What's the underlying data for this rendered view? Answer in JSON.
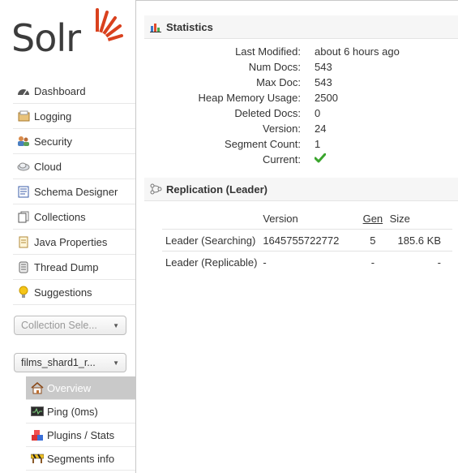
{
  "app": {
    "logo_text": "Solr"
  },
  "sidebar": {
    "items": [
      {
        "label": "Dashboard",
        "icon": "dashboard-icon"
      },
      {
        "label": "Logging",
        "icon": "logging-icon"
      },
      {
        "label": "Security",
        "icon": "security-icon"
      },
      {
        "label": "Cloud",
        "icon": "cloud-icon"
      },
      {
        "label": "Schema Designer",
        "icon": "schema-designer-icon"
      },
      {
        "label": "Collections",
        "icon": "collections-icon"
      },
      {
        "label": "Java Properties",
        "icon": "java-properties-icon"
      },
      {
        "label": "Thread Dump",
        "icon": "thread-dump-icon"
      },
      {
        "label": "Suggestions",
        "icon": "suggestions-icon"
      }
    ],
    "collection_selector": {
      "value": "Collection Sele..."
    },
    "core_selector": {
      "value": "films_shard1_r..."
    },
    "core_menu": [
      {
        "label": "Overview",
        "icon": "home-icon",
        "active": true
      },
      {
        "label": "Ping (0ms)",
        "icon": "ping-icon"
      },
      {
        "label": "Plugins / Stats",
        "icon": "plugins-icon"
      },
      {
        "label": "Segments info",
        "icon": "segments-icon"
      }
    ]
  },
  "statistics": {
    "title": "Statistics",
    "rows": [
      {
        "label": "Last Modified:",
        "value": "about 6 hours ago"
      },
      {
        "label": "Num Docs:",
        "value": "543"
      },
      {
        "label": "Max Doc:",
        "value": "543"
      },
      {
        "label": "Heap Memory Usage:",
        "value": "2500"
      },
      {
        "label": "Deleted Docs:",
        "value": "0"
      },
      {
        "label": "Version:",
        "value": "24"
      },
      {
        "label": "Segment Count:",
        "value": "1"
      },
      {
        "label": "Current:",
        "value": "",
        "icon": "checkmark-icon"
      }
    ]
  },
  "replication": {
    "title": "Replication (Leader)",
    "columns": [
      "",
      "Version",
      "Gen",
      "Size"
    ],
    "rows": [
      {
        "name": "Leader (Searching)",
        "version": "1645755722772",
        "gen": "5",
        "size": "185.6 KB"
      },
      {
        "name": "Leader (Replicable)",
        "version": "-",
        "gen": "-",
        "size": "-"
      }
    ]
  },
  "colors": {
    "brand": "#d9411e",
    "check": "#3aa52d",
    "active_bg": "#c9c9c9"
  }
}
